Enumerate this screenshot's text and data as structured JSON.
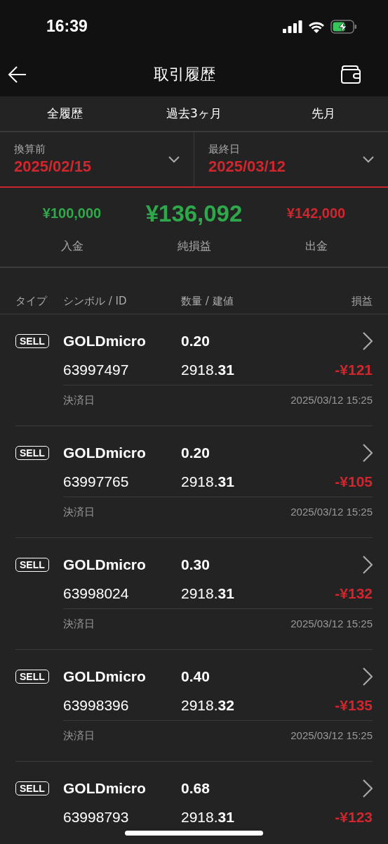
{
  "status_bar": {
    "time": "16:39"
  },
  "header": {
    "title": "取引履歴"
  },
  "tabs": [
    {
      "label": "全履歴"
    },
    {
      "label": "過去3ヶ月"
    },
    {
      "label": "先月"
    }
  ],
  "date_range": [
    {
      "label": "換算前",
      "value": "2025/02/15"
    },
    {
      "label": "最終日",
      "value": "2025/03/12"
    }
  ],
  "summary": [
    {
      "kind": "side",
      "color": "#2ea84a",
      "amount": "¥100,000",
      "label": "入金"
    },
    {
      "kind": "main",
      "color": "#2ea84a",
      "amount": "¥136,092",
      "label": "純損益"
    },
    {
      "kind": "side",
      "color": "#d0262d",
      "amount": "¥142,000",
      "label": "出金"
    }
  ],
  "table": {
    "columns": [
      "タイプ",
      "シンボル / ID",
      "数量 / 建値",
      "損益"
    ],
    "rows": [
      {
        "type": "SELL",
        "symbol": "GOLDmicro",
        "id": "63997497",
        "volume": "0.20",
        "price": "2918.**31**",
        "profit": "-¥121",
        "settle_label": "決済日",
        "settle_time": "2025/03/12 15:25"
      },
      {
        "type": "SELL",
        "symbol": "GOLDmicro",
        "id": "63997765",
        "volume": "0.20",
        "price": "2918.**31**",
        "profit": "-¥105",
        "settle_label": "決済日",
        "settle_time": "2025/03/12 15:25"
      },
      {
        "type": "SELL",
        "symbol": "GOLDmicro",
        "id": "63998024",
        "volume": "0.30",
        "price": "2918.**31**",
        "profit": "-¥132",
        "settle_label": "決済日",
        "settle_time": "2025/03/12 15:25"
      },
      {
        "type": "SELL",
        "symbol": "GOLDmicro",
        "id": "63998396",
        "volume": "0.40",
        "price": "2918.**32**",
        "profit": "-¥135",
        "settle_label": "決済日",
        "settle_time": "2025/03/12 15:25"
      },
      {
        "type": "SELL",
        "symbol": "GOLDmicro",
        "id": "63998793",
        "volume": "0.68",
        "price": "2918.**31**",
        "profit": "-¥123"
      }
    ]
  }
}
